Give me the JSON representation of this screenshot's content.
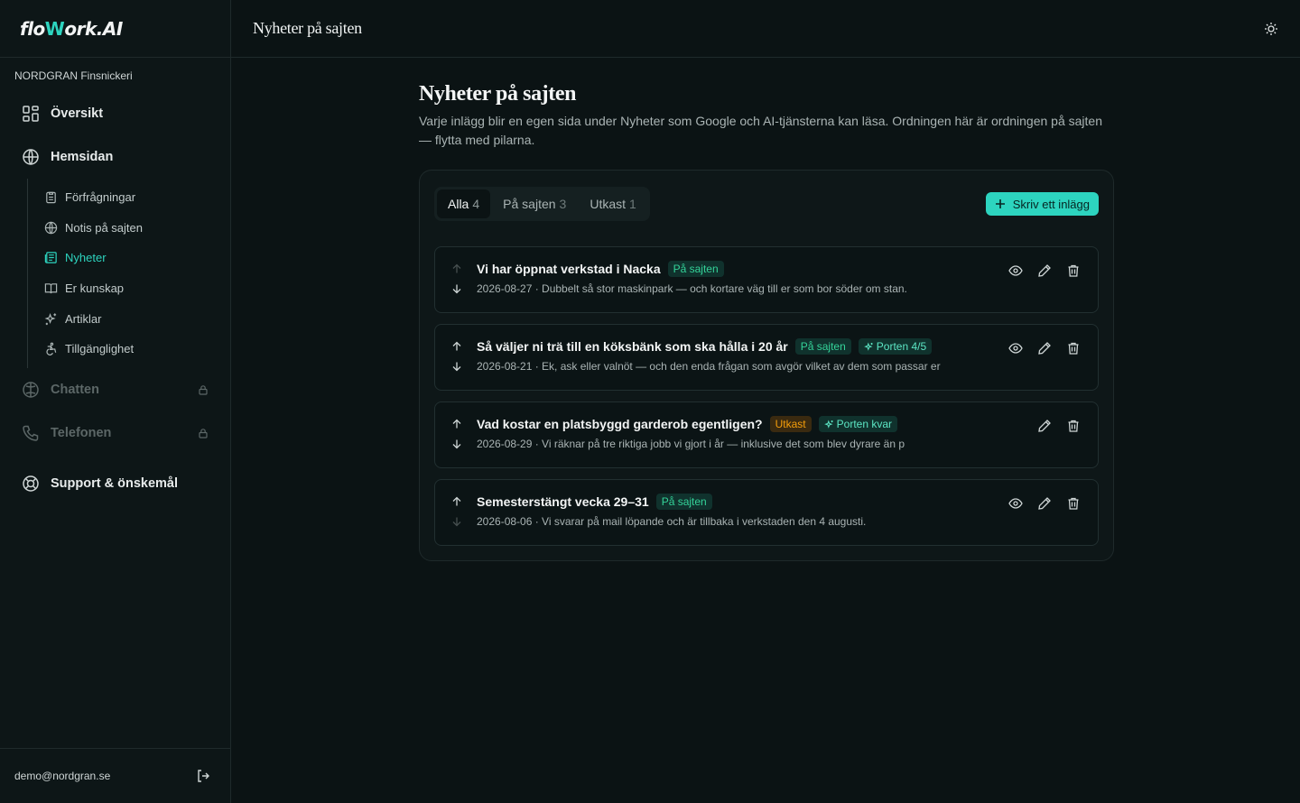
{
  "brand": {
    "name_part1": "flo",
    "name_part2": "W",
    "name_part3": "ork.AI",
    "accent": "#2dd4bf"
  },
  "org_name": "NORDGRAN Finsnickeri",
  "nav": {
    "overview": "Översikt",
    "website": "Hemsidan",
    "sub_items": [
      {
        "label": "Förfrågningar",
        "icon": "clipboard-icon"
      },
      {
        "label": "Notis på sajten",
        "icon": "globe-icon"
      },
      {
        "label": "Nyheter",
        "icon": "newspaper-icon",
        "active": true
      },
      {
        "label": "Er kunskap",
        "icon": "book-icon"
      },
      {
        "label": "Artiklar",
        "icon": "sparkles-icon"
      },
      {
        "label": "Tillgänglighet",
        "icon": "accessibility-icon"
      }
    ],
    "chat": "Chatten",
    "phone": "Telefonen",
    "support": "Support & önskemål"
  },
  "user_email": "demo@nordgran.se",
  "topbar": {
    "title": "Nyheter på sajten"
  },
  "page": {
    "title": "Nyheter på sajten",
    "description": "Varje inlägg blir en egen sida under Nyheter som Google och AI-tjänsterna kan läsa. Ordningen här är ordningen på sajten — flytta med pilarna."
  },
  "tabs": [
    {
      "label": "Alla",
      "count": "4",
      "active": true
    },
    {
      "label": "På sajten",
      "count": "3"
    },
    {
      "label": "Utkast",
      "count": "1"
    }
  ],
  "write_button": "Skriv ett inlägg",
  "posts": [
    {
      "title": "Vi har öppnat verkstad i Nacka",
      "status": "På sajten",
      "port": "",
      "meta": "2026-08-27 · Dubbelt så stor maskinpark — och kortare väg till er som bor söder om stan."
    },
    {
      "title": "Så väljer ni trä till en köksbänk som ska hålla i 20 år",
      "status": "På sajten",
      "port": "Porten 4/5",
      "meta": "2026-08-21 · Ek, ask eller valnöt — och den enda frågan som avgör vilket av dem som passar er"
    },
    {
      "title": "Vad kostar en platsbyggd garderob egentligen?",
      "status": "Utkast",
      "port": "Porten kvar",
      "meta": "2026-08-29 · Vi räknar på tre riktiga jobb vi gjort i år — inklusive det som blev dyrare än p"
    },
    {
      "title": "Semesterstängt vecka 29–31",
      "status": "På sajten",
      "port": "",
      "meta": "2026-08-06 · Vi svarar på mail löpande och är tillbaka i verkstaden den 4 augusti."
    }
  ]
}
